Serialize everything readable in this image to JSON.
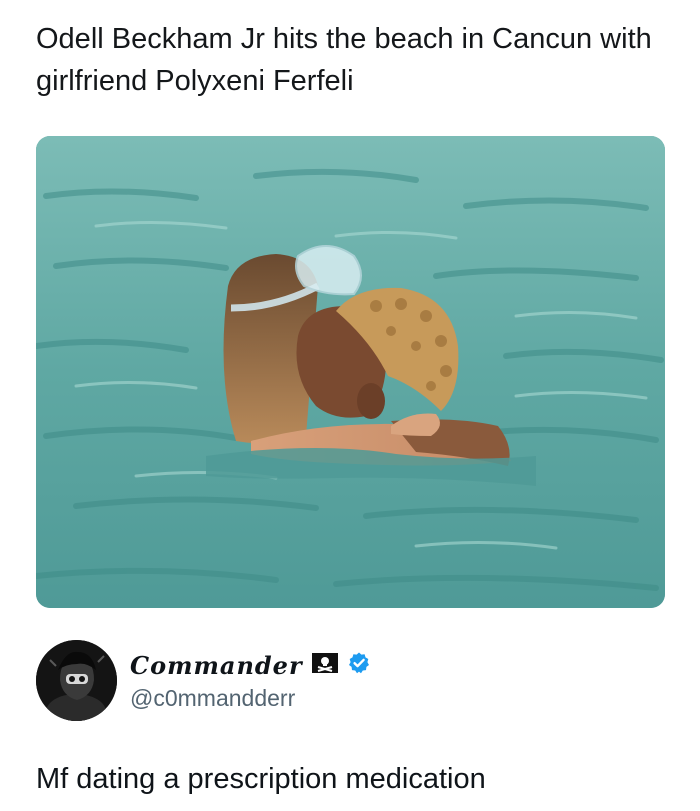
{
  "quoted_post": {
    "text": "Odell Beckham Jr hits the beach in Cancun with girlfriend Polyxeni Ferfeli"
  },
  "media": {
    "icon": "photo-couple-in-sea",
    "water_color": "#5fa8a3"
  },
  "author": {
    "display_name": "Commander",
    "flag_icon": "pirate-flag-icon",
    "verified_icon": "verified-badge-icon",
    "verified_color": "#1d9bf0",
    "handle": "@c0mmandderr"
  },
  "reply": {
    "text": "Mf dating a prescription medication"
  }
}
